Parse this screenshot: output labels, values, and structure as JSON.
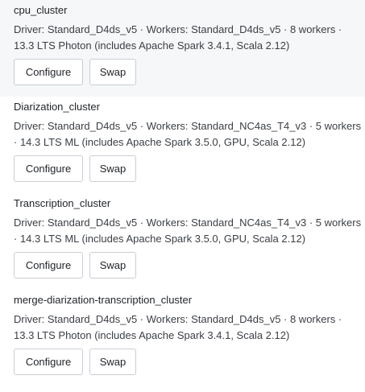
{
  "clusters": [
    {
      "name": "cpu_cluster",
      "description": "Driver: Standard_D4ds_v5 · Workers: Standard_D4ds_v5 · 8 workers · 13.3 LTS Photon (includes Apache Spark 3.4.1, Scala 2.12)",
      "configure_label": "Configure",
      "swap_label": "Swap"
    },
    {
      "name": "Diarization_cluster",
      "description": "Driver: Standard_D4ds_v5 · Workers: Standard_NC4as_T4_v3 · 5 workers · 14.3 LTS ML (includes Apache Spark 3.5.0, GPU, Scala 2.12)",
      "configure_label": "Configure",
      "swap_label": "Swap"
    },
    {
      "name": "Transcription_cluster",
      "description": "Driver: Standard_D4ds_v5 · Workers: Standard_NC4as_T4_v3 · 5 workers · 14.3 LTS ML (includes Apache Spark 3.5.0, GPU, Scala 2.12)",
      "configure_label": "Configure",
      "swap_label": "Swap"
    },
    {
      "name": "merge-diarization-transcription_cluster",
      "description": "Driver: Standard_D4ds_v5 · Workers: Standard_D4ds_v5 · 8 workers · 13.3 LTS Photon (includes Apache Spark 3.4.1, Scala 2.12)",
      "configure_label": "Configure",
      "swap_label": "Swap"
    }
  ]
}
